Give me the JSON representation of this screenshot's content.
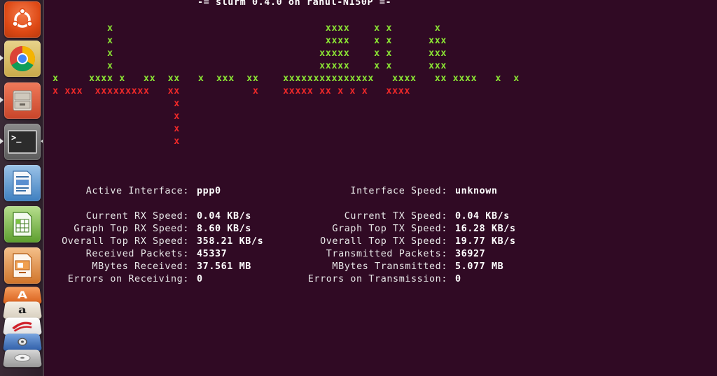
{
  "terminal": {
    "header": "-= slurm 0.4.0 on rahul-N150P =-",
    "graph_rx": [
      "         x                                   xxxx    x x       x",
      "         x                                   xxxx    x x      xxx",
      "         x                                  xxxxx    x x      xxx",
      "         x                                  xxxxx    x x      xxx",
      "x     xxxx x   xx  xx   x  xxx  xx    xxxxxxxxxxxxxxx   xxxx   xx xxxx   x  x"
    ],
    "graph_tx": [
      "x xxx  xxxxxxxxx   xx            x    xxxxx xx x x x   xxxx",
      "                    x",
      "                    x",
      "                    x",
      "                    x"
    ],
    "left_stats": [
      {
        "label": "Active Interface:",
        "value": "ppp0"
      },
      {
        "label": "",
        "value": ""
      },
      {
        "label": "Current RX Speed:",
        "value": "0.04 KB/s"
      },
      {
        "label": "Graph Top RX Speed:",
        "value": "8.60 KB/s"
      },
      {
        "label": "Overall Top RX Speed:",
        "value": "358.21 KB/s"
      },
      {
        "label": "Received Packets:",
        "value": "45337"
      },
      {
        "label": "MBytes Received:",
        "value": "37.561 MB"
      },
      {
        "label": "Errors on Receiving:",
        "value": "0"
      }
    ],
    "right_stats": [
      {
        "label": "Interface Speed:",
        "value": "unknown"
      },
      {
        "label": "",
        "value": ""
      },
      {
        "label": "Current TX Speed:",
        "value": "0.04 KB/s"
      },
      {
        "label": "Graph Top TX Speed:",
        "value": "16.28 KB/s"
      },
      {
        "label": "Overall Top TX Speed:",
        "value": "19.77 KB/s"
      },
      {
        "label": "Transmitted Packets:",
        "value": "36927"
      },
      {
        "label": "MBytes Transmitted:",
        "value": "5.077 MB"
      },
      {
        "label": "Errors on Transmission:",
        "value": "0"
      }
    ]
  },
  "launcher": {
    "items": [
      {
        "name": "ubuntu-dash",
        "icon": "ubuntu-logo-icon"
      },
      {
        "name": "chrome",
        "icon": "chrome-icon"
      },
      {
        "name": "file-manager",
        "icon": "file-cabinet-icon"
      },
      {
        "name": "terminal",
        "icon": "terminal-icon",
        "glyph": ">_"
      },
      {
        "name": "libreoffice-writer",
        "icon": "writer-icon"
      },
      {
        "name": "libreoffice-calc",
        "icon": "calc-icon"
      },
      {
        "name": "libreoffice-impress",
        "icon": "impress-icon"
      }
    ],
    "stacked": [
      {
        "name": "software-center",
        "icon": "software-center-icon",
        "glyph": "A"
      },
      {
        "name": "amazon",
        "icon": "amazon-icon",
        "glyph": "a"
      },
      {
        "name": "filezilla",
        "icon": "filezilla-icon"
      },
      {
        "name": "system-settings",
        "icon": "settings-icon"
      },
      {
        "name": "drive",
        "icon": "disk-icon"
      }
    ]
  },
  "colors": {
    "background": "#300a24",
    "rx_graph": "#8ae234",
    "tx_graph": "#ef2929",
    "text": "#ffffff"
  }
}
